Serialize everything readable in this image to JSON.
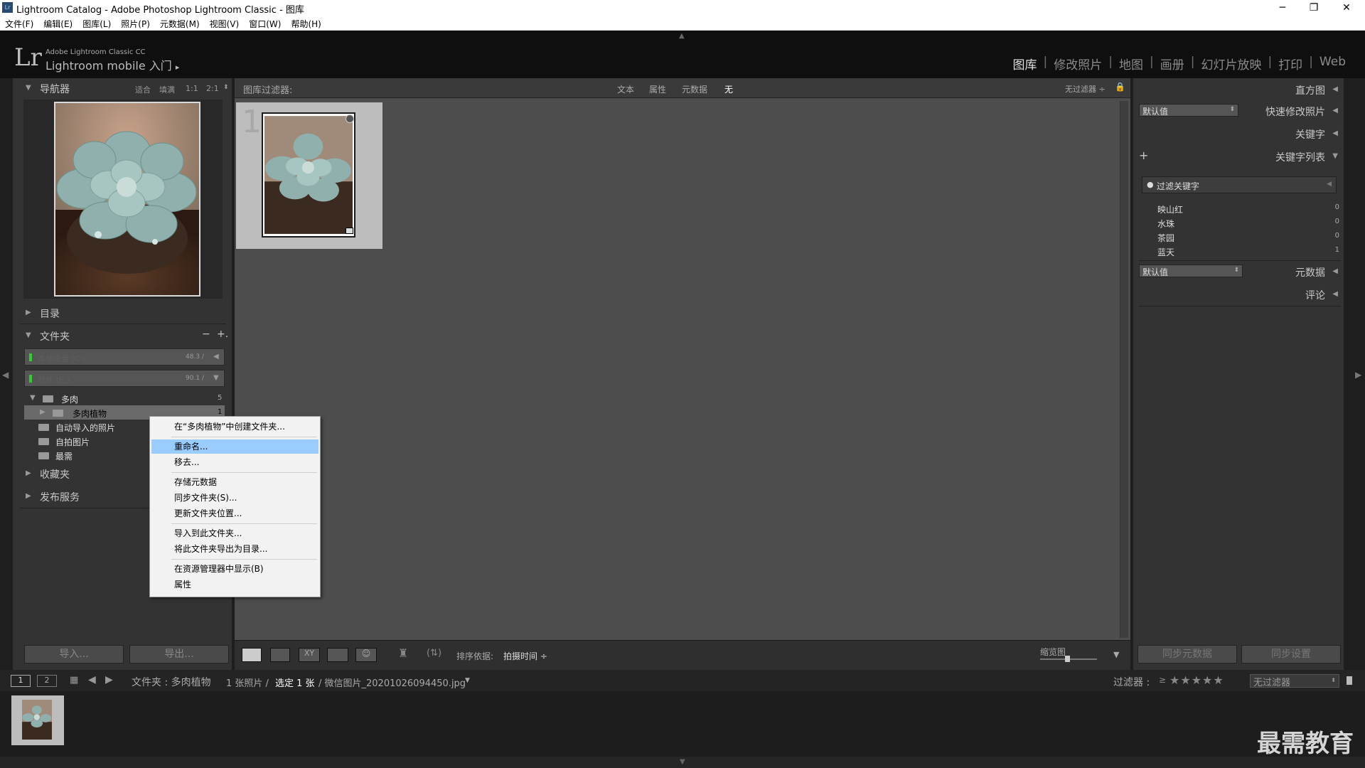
{
  "window": {
    "title": "Lightroom Catalog - Adobe Photoshop Lightroom Classic - 图库",
    "logo": "Lr",
    "controls": [
      "─",
      "❐",
      "✕"
    ]
  },
  "menubar": [
    "文件(F)",
    "编辑(E)",
    "图库(L)",
    "照片(P)",
    "元数据(M)",
    "视图(V)",
    "窗口(W)",
    "帮助(H)"
  ],
  "identity": {
    "logo": "Lr",
    "line1": "Adobe Lightroom Classic CC",
    "line2": "Lightroom mobile 入门",
    "arrow": "▸"
  },
  "modules": [
    {
      "label": "图库",
      "active": true
    },
    {
      "label": "修改照片"
    },
    {
      "label": "地图"
    },
    {
      "label": "画册"
    },
    {
      "label": "幻灯片放映"
    },
    {
      "label": "打印"
    },
    {
      "label": "Web"
    }
  ],
  "navigator": {
    "title": "导航器",
    "options": [
      "适合",
      "填满",
      "1:1",
      "2:1"
    ]
  },
  "left": {
    "catalog": "目录",
    "folders": "文件夹",
    "folders_minus": "−",
    "folders_plus": "+.",
    "volumes": [
      {
        "name": "本地磁盘 (C:)",
        "size": "48.3 /",
        "arrow": "◀"
      },
      {
        "name": "软件 (E:)",
        "size": "90.1 /",
        "arrow": "▼"
      }
    ],
    "tree": [
      {
        "label": "多肉",
        "count": "5"
      },
      {
        "label": "多肉植物",
        "count": "1"
      },
      {
        "label": "自动导入的照片",
        "count": ""
      },
      {
        "label": "自拍图片",
        "count": ""
      },
      {
        "label": "最需",
        "count": ""
      }
    ],
    "collections": "收藏夹",
    "publish": "发布服务",
    "import_btn": "导入...",
    "export_btn": "导出..."
  },
  "filterbar": {
    "label": "图库过滤器:",
    "options": [
      "文本",
      "属性",
      "元数据",
      "无"
    ],
    "preset": "无过滤器 ÷",
    "lock": "🔒"
  },
  "grid": {
    "index": "1"
  },
  "toolbar": {
    "sort_label": "排序依据:",
    "sort_value": "拍摄时间 ÷",
    "thumb_label": "缩览图",
    "arrow": "▼"
  },
  "right": {
    "histogram": "直方图",
    "preset_default": "默认值",
    "quick_develop": "快速修改照片",
    "keywords": "关键字",
    "keyword_list": "关键字列表",
    "plus": "+",
    "filter_placeholder": "过滤关键字",
    "keyword_items": [
      {
        "label": "映山红",
        "count": "0"
      },
      {
        "label": "水珠",
        "count": "0"
      },
      {
        "label": "茶园",
        "count": "0"
      },
      {
        "label": "蓝天",
        "count": "1"
      }
    ],
    "metadata_default": "默认值",
    "metadata": "元数据",
    "comments": "评论",
    "sync_metadata": "同步元数据",
    "sync_settings": "同步设置"
  },
  "filmbar": {
    "page1": "1",
    "page2": "2",
    "path": "文件夹 : 多肉植物",
    "count": "1 张照片 /",
    "selected": "选定 1 张",
    "filename": "/ 微信图片_20201026094450.jpg",
    "filename_arrow": "▼",
    "filter_label": "过滤器 :",
    "filter_op": "≥",
    "stars": "★★★★★",
    "filter_value": "无过滤器"
  },
  "context_menu": [
    {
      "label": "在“多肉植物”中创建文件夹..."
    },
    {
      "label": "重命名...",
      "highlighted": true
    },
    {
      "label": "移去..."
    },
    {
      "label": "存储元数据"
    },
    {
      "label": "同步文件夹(S)..."
    },
    {
      "label": "更新文件夹位置..."
    },
    {
      "label": "导入到此文件夹..."
    },
    {
      "label": "将此文件夹导出为目录..."
    },
    {
      "label": "在资源管理器中显示(B)"
    },
    {
      "label": "属性"
    }
  ],
  "watermark": "最需教育",
  "colors": {
    "accent": "#99ccff",
    "panel": "#333333",
    "center": "#4d4d4d"
  }
}
